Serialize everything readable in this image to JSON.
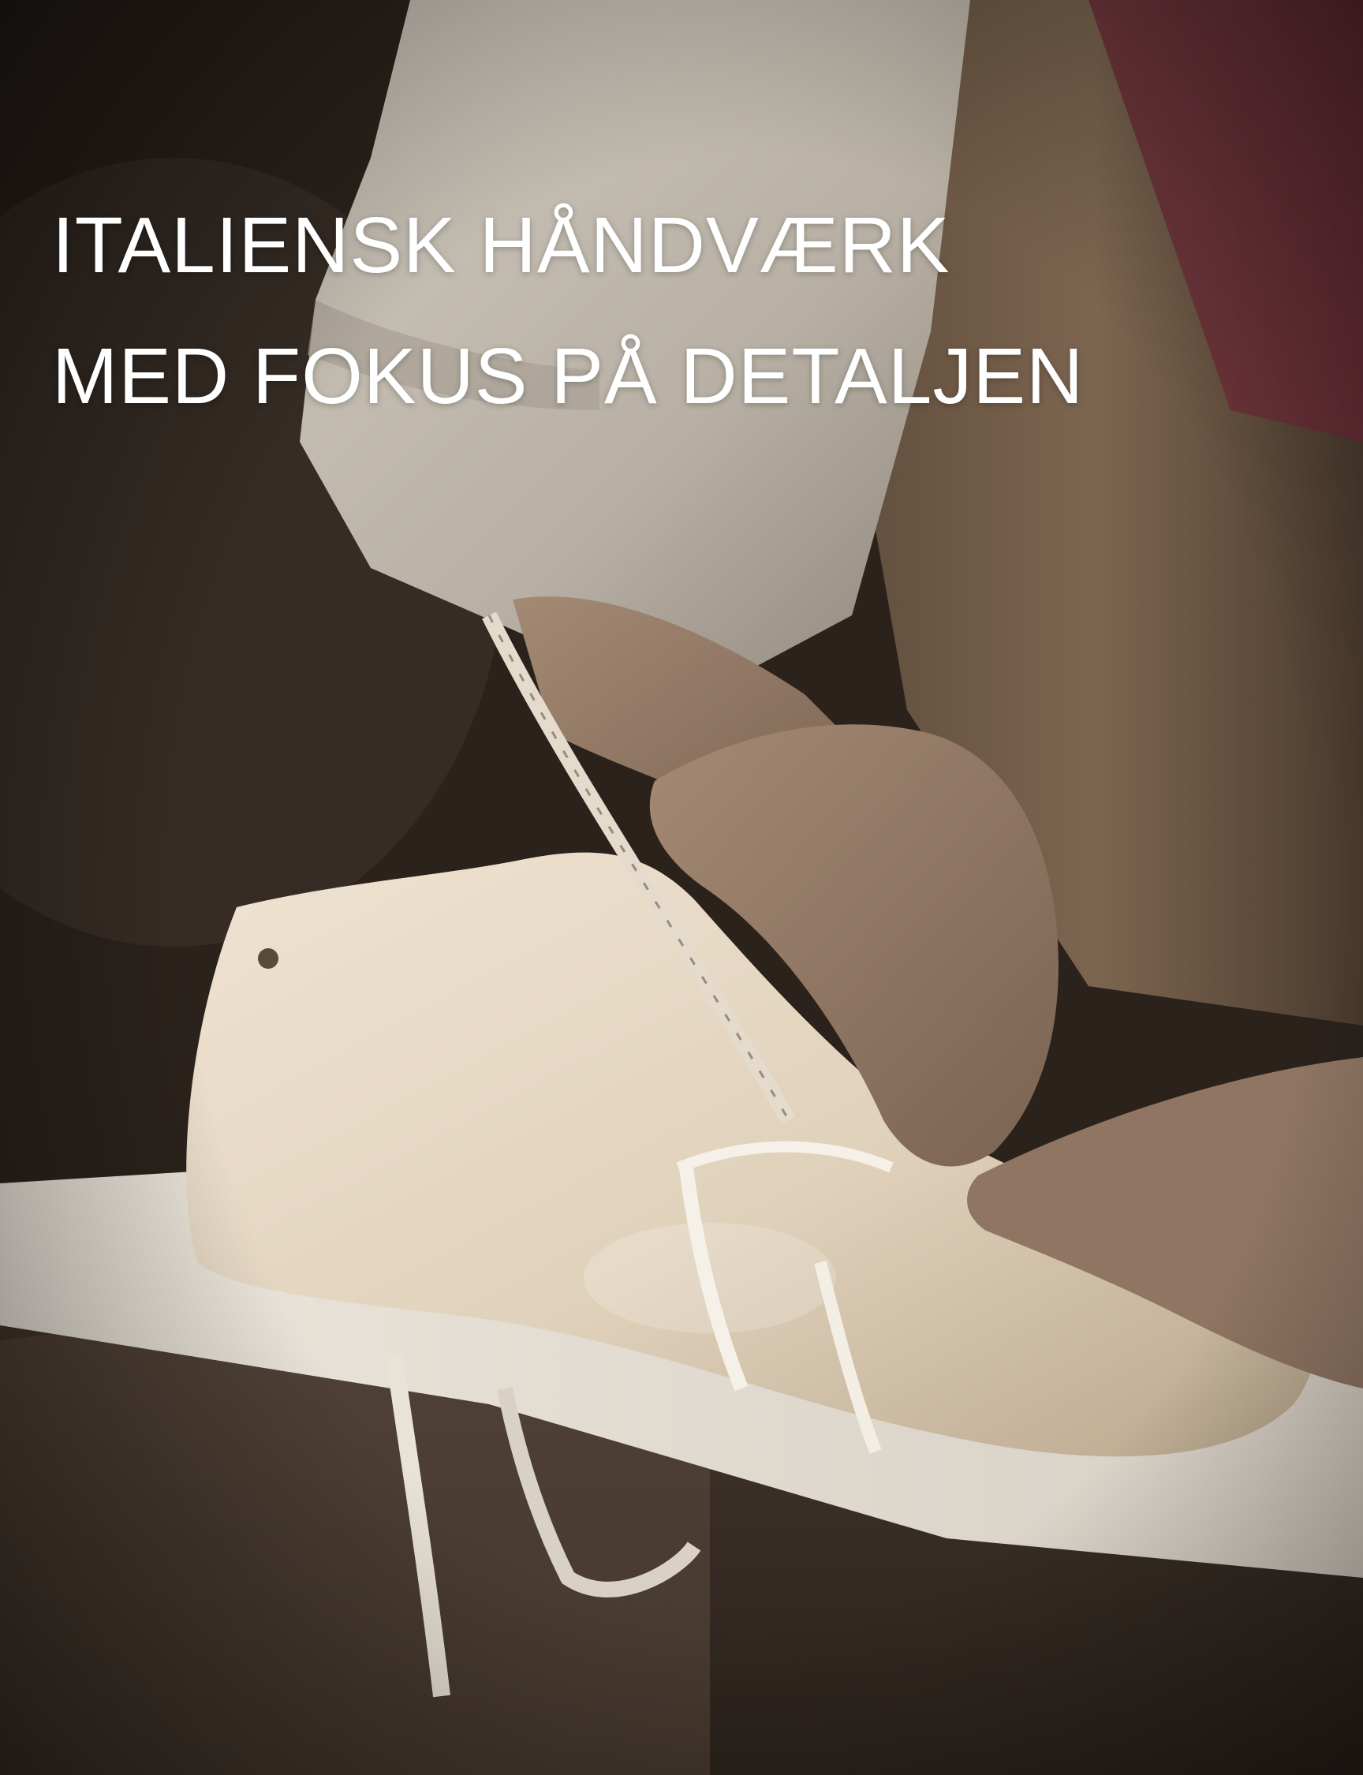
{
  "headline": {
    "line1": "ITALIENSK HÅNDVÆRK",
    "line2": "MED FOKUS PÅ DETALJEN"
  },
  "colors": {
    "text": "#ffffff",
    "background_dark": "#2a211b",
    "last_wood": "#e3d6c2",
    "shirt": "#d8d2c8",
    "apron": "#6e5a45"
  }
}
